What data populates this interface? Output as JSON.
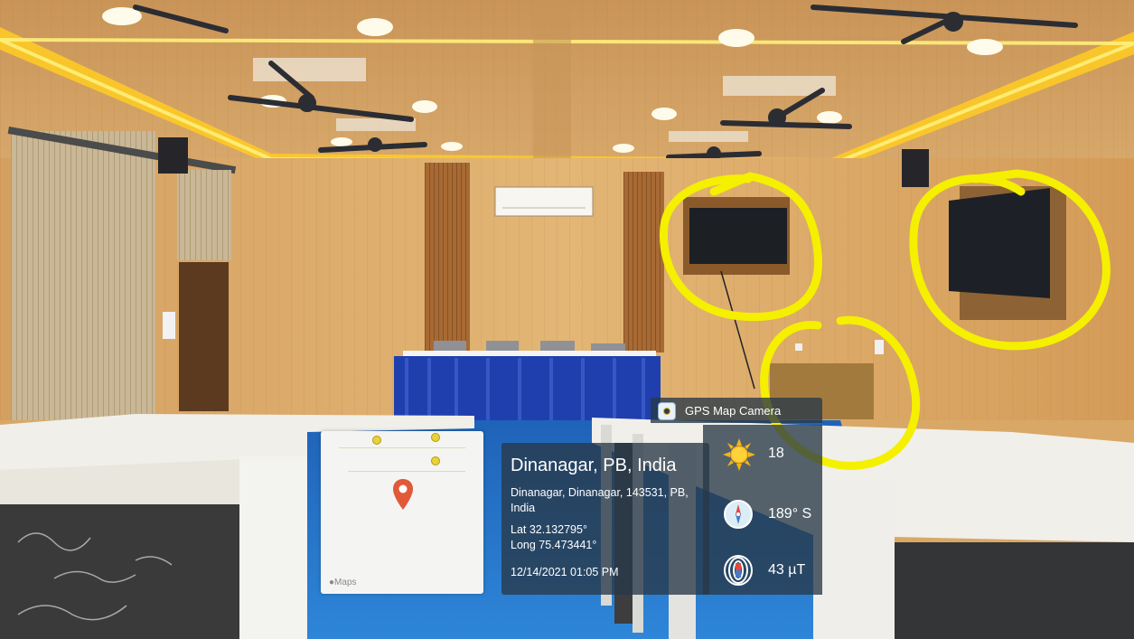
{
  "map_card": {
    "attribution": "Maps",
    "icons": {
      "pin": "location-pin-icon",
      "logo": "apple-logo-icon"
    },
    "pin_color": "#e05a3a"
  },
  "gps_tag": {
    "label": "GPS Map Camera",
    "icon": "camera-icon"
  },
  "location": {
    "city": "Dinanagar, PB, India",
    "address": "Dinanagar, Dinanagar, 143531, PB, India",
    "latitude": "Lat 32.132795°",
    "longitude": "Long 75.473441°",
    "datetime": "12/14/2021 01:05 PM"
  },
  "stats": [
    {
      "icon": "sun-icon",
      "value": "18"
    },
    {
      "icon": "compass-icon",
      "value": "189° S"
    },
    {
      "icon": "magnet-icon",
      "value": "43 µT"
    }
  ],
  "colors": {
    "annotation": "#f5ef00",
    "overlay": "#283848"
  }
}
